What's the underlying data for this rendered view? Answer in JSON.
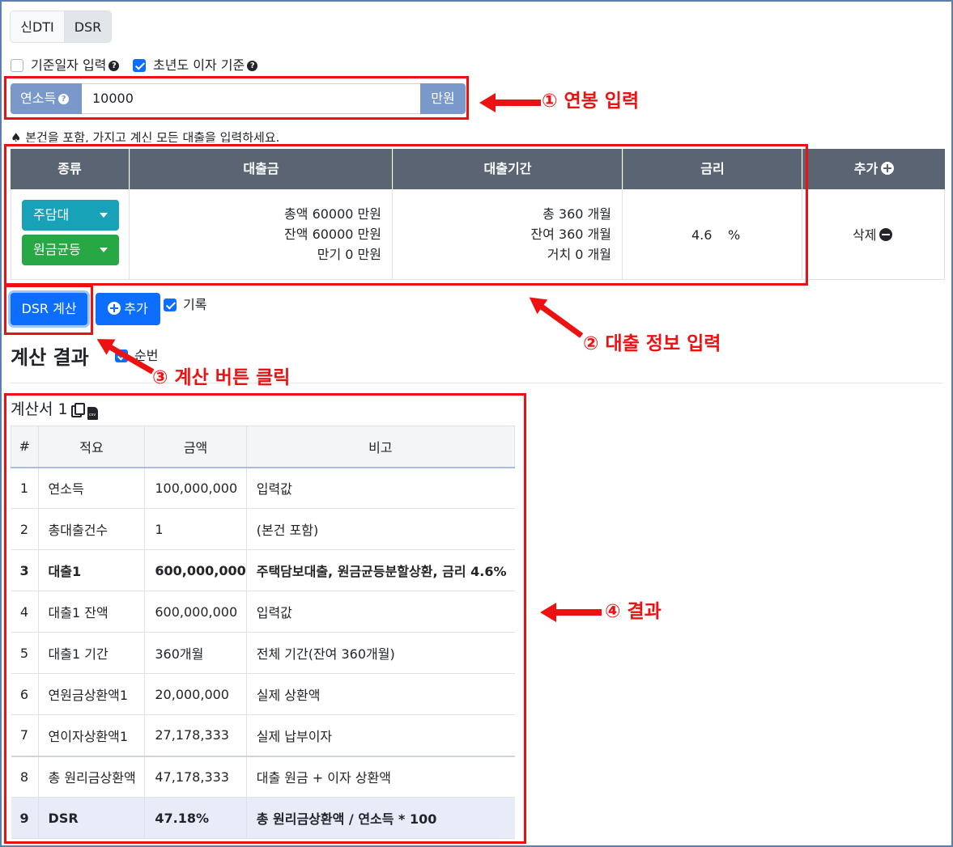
{
  "tabs": [
    {
      "label": "신DTI"
    },
    {
      "label": "DSR"
    }
  ],
  "options": {
    "base_date": {
      "label": "기준일자 입력",
      "checked": false
    },
    "first_year_interest": {
      "label": "초년도 이자 기준",
      "checked": true
    }
  },
  "income": {
    "label": "연소득",
    "value": "10000",
    "unit": "만원"
  },
  "note": "본건을 포함, 가지고 계신 모든 대출을 입력하세요.",
  "loan_table": {
    "headers": [
      "종류",
      "대출금",
      "대출기간",
      "금리",
      "추가"
    ],
    "rows": [
      {
        "type": "주담대",
        "method": "원금균등",
        "amount_lines": [
          "총액 60000 만원",
          "잔액 60000 만원",
          "만기 0 만원"
        ],
        "period_lines": [
          "총 360 개월",
          "잔여 360 개월",
          "거치 0 개월"
        ],
        "rate": "4.6",
        "rate_unit": "%",
        "delete_label": "삭제"
      }
    ]
  },
  "actions": {
    "calc_label": "DSR 계산",
    "add_label": "추가",
    "record_label": "기록",
    "record_checked": true
  },
  "result": {
    "heading": "계산 결과",
    "order_label": "순번",
    "sheet_title": "계산서 1",
    "headers": [
      "#",
      "적요",
      "금액",
      "비고"
    ],
    "rows": [
      {
        "n": "1",
        "item": "연소득",
        "amount": "100,000,000",
        "note": "입력값"
      },
      {
        "n": "2",
        "item": "총대출건수",
        "amount": "1",
        "note": "(본건 포함)"
      },
      {
        "n": "3",
        "item": "대출1",
        "amount": "600,000,000",
        "note": "주택담보대출, 원금균등분할상환, 금리 4.6%"
      },
      {
        "n": "4",
        "item": "대출1 잔액",
        "amount": "600,000,000",
        "note": "입력값"
      },
      {
        "n": "5",
        "item": "대출1 기간",
        "amount": "360개월",
        "note": "전체 기간(잔여 360개월)"
      },
      {
        "n": "6",
        "item": "연원금상환액1",
        "amount": "20,000,000",
        "note": "실제 상환액"
      },
      {
        "n": "7",
        "item": "연이자상환액1",
        "amount": "27,178,333",
        "note": "실제 납부이자"
      },
      {
        "n": "8",
        "item": "총 원리금상환액",
        "amount": "47,178,333",
        "note": "대출 원금 + 이자 상환액"
      },
      {
        "n": "9",
        "item": "DSR",
        "amount": "47.18%",
        "note": "총 원리금상환액 / 연소득 * 100"
      }
    ]
  },
  "annotations": {
    "a1": "① 연봉 입력",
    "a2": "② 대출 정보 입력",
    "a3": "③ 계산 버튼 클릭",
    "a4": "④ 결과",
    "color": "#ee1111"
  },
  "colors": {
    "primary": "#0d6efd",
    "income_addon": "#7a98c9",
    "header_dark": "#5a6472",
    "dropdown_teal": "#17a2b8",
    "dropdown_green": "#28a745"
  }
}
